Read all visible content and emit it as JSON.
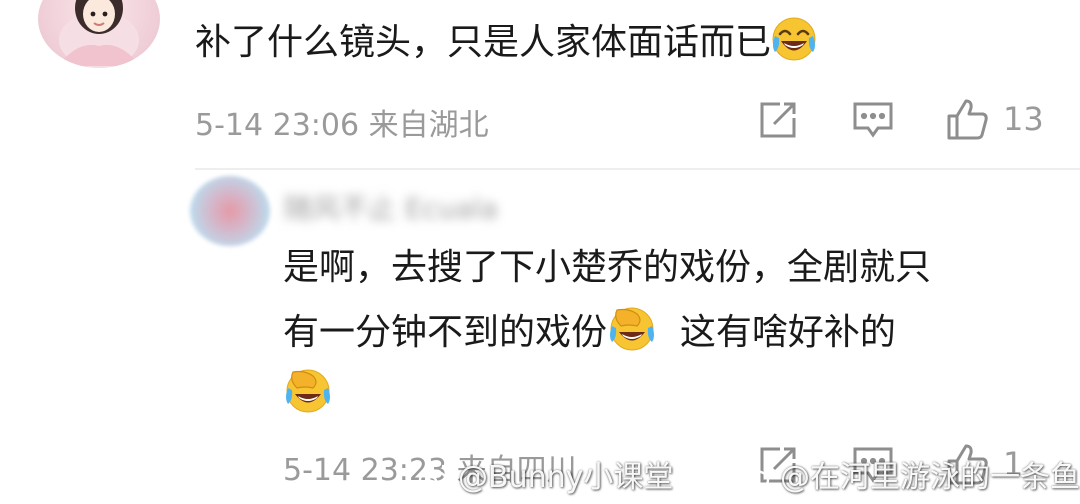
{
  "comment1": {
    "text": "补了什么镜头，只是人家体面话而已",
    "emoji": "laughing-crying-emoji",
    "date": "5-14 23:06",
    "location": "来自湖北",
    "like_count": "13"
  },
  "reply": {
    "blurred_name": "随风不止 Ecuala",
    "line1": "是啊，去搜了下小楚乔的戏份，全剧就只",
    "line2_a": "有一分钟不到的戏份",
    "line2_b": "这有啥好补的",
    "date": "5-14 23:23",
    "location": "来自四川",
    "like_count": "1"
  },
  "watermarks": {
    "left": "@Bunny小课堂",
    "right": "@在河里游泳的一条鱼"
  },
  "colors": {
    "meta_gray": "#9a9a9a",
    "icon_gray": "#8e8e8e",
    "emoji_yellow": "#f7c531"
  }
}
